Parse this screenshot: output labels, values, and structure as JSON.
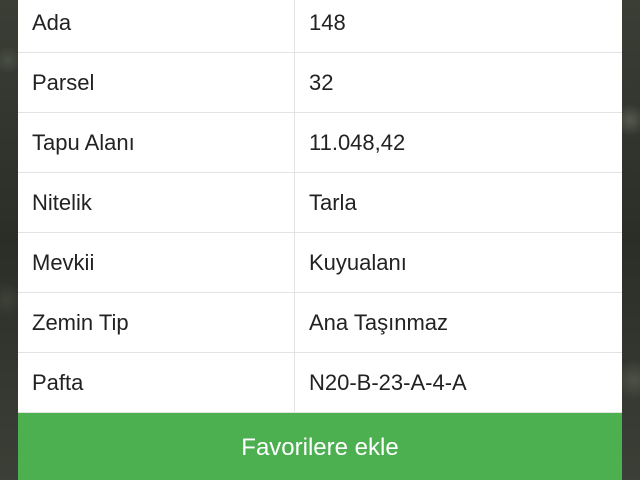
{
  "parcel_info": {
    "rows": [
      {
        "label": "Ada",
        "value": "148"
      },
      {
        "label": "Parsel",
        "value": "32"
      },
      {
        "label": "Tapu Alanı",
        "value": "11.048,42"
      },
      {
        "label": "Nitelik",
        "value": "Tarla"
      },
      {
        "label": "Mevkii",
        "value": "Kuyualanı"
      },
      {
        "label": "Zemin Tip",
        "value": "Ana Taşınmaz"
      },
      {
        "label": "Pafta",
        "value": "N20-B-23-A-4-A"
      }
    ]
  },
  "actions": {
    "favorite_label": "Favorilere ekle"
  },
  "colors": {
    "button_green": "#4caf50",
    "panel_bg": "#ffffff",
    "row_border": "#e3e3e3"
  }
}
